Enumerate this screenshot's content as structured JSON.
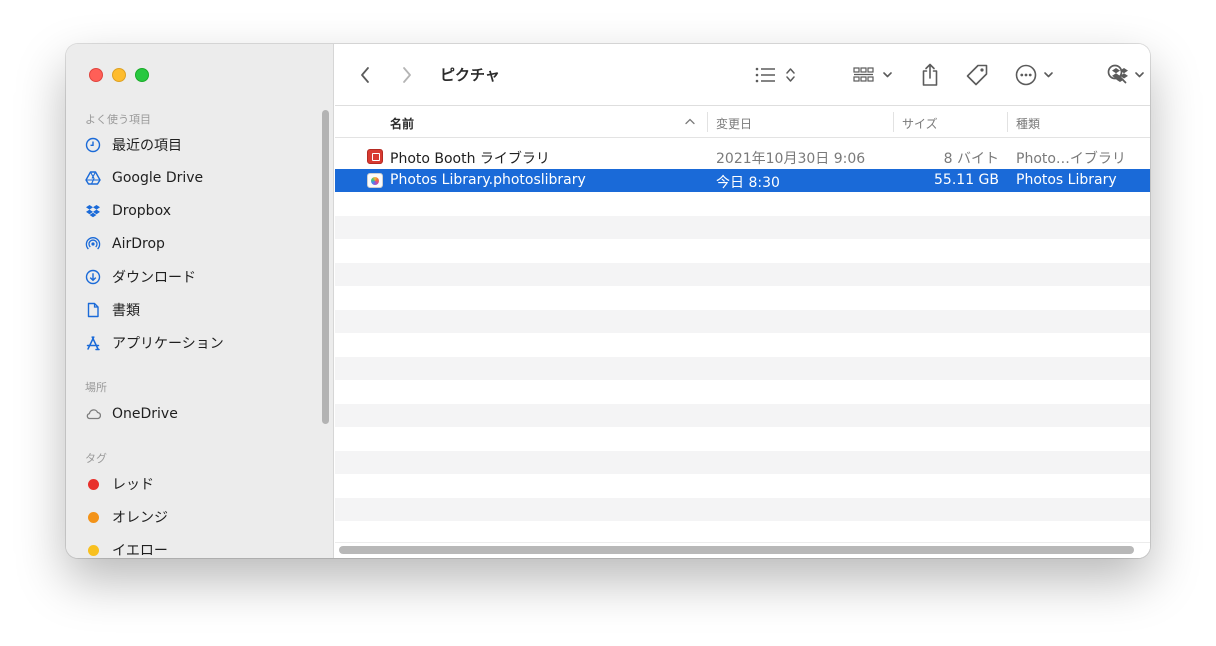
{
  "window": {
    "title": "ピクチャ"
  },
  "sidebar": {
    "sections": [
      {
        "title": "よく使う項目"
      },
      {
        "title": "場所"
      },
      {
        "title": "タグ"
      }
    ],
    "favorites": [
      {
        "label": "最近の項目",
        "icon": "clock-icon"
      },
      {
        "label": "Google Drive",
        "icon": "google-drive-icon"
      },
      {
        "label": "Dropbox",
        "icon": "dropbox-icon"
      },
      {
        "label": "AirDrop",
        "icon": "airdrop-icon"
      },
      {
        "label": "ダウンロード",
        "icon": "download-icon"
      },
      {
        "label": "書類",
        "icon": "document-icon"
      },
      {
        "label": "アプリケーション",
        "icon": "applications-icon"
      }
    ],
    "locations": [
      {
        "label": "OneDrive",
        "icon": "cloud-icon"
      }
    ],
    "tags": [
      {
        "label": "レッド",
        "color": "#e8302c"
      },
      {
        "label": "オレンジ",
        "color": "#f39319"
      },
      {
        "label": "イエロー",
        "color": "#f8c01f"
      }
    ]
  },
  "columns": {
    "name": "名前",
    "date": "変更日",
    "size": "サイズ",
    "kind": "種類"
  },
  "files": [
    {
      "name": "Photo Booth ライブラリ",
      "date": "2021年10月30日 9:06",
      "size": "8 バイト",
      "kind": "Photo…イブラリ",
      "selected": false
    },
    {
      "name": "Photos Library.photoslibrary",
      "date": "今日 8:30",
      "size": "55.11 GB",
      "kind": "Photos Library",
      "selected": true
    }
  ],
  "colors": {
    "selection": "#1a6ad8",
    "sidebar_bg": "#ececec"
  }
}
